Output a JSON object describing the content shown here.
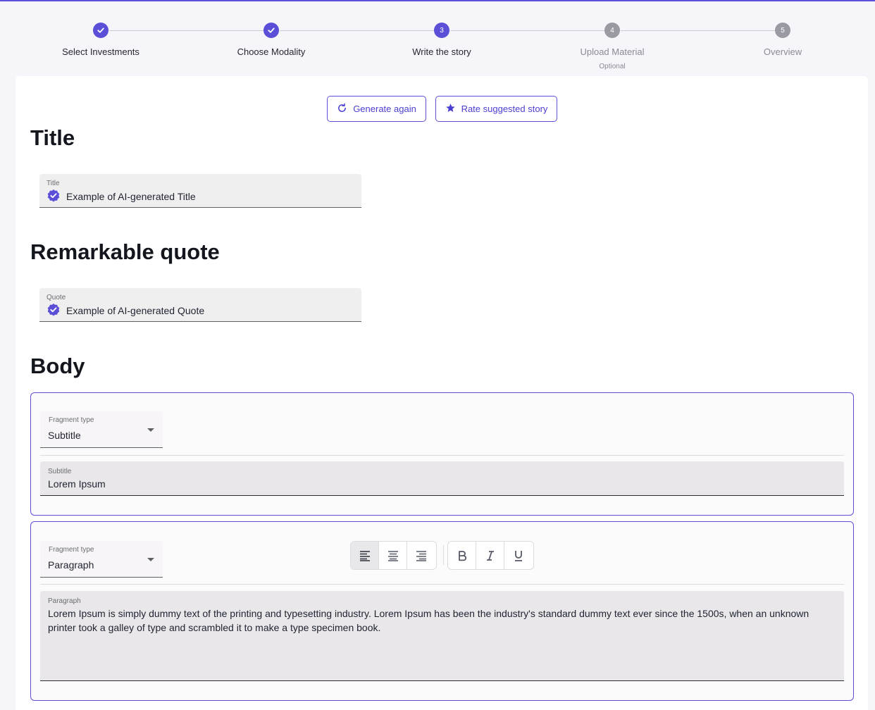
{
  "stepper": {
    "steps": [
      {
        "label": "Select Investments",
        "marker": "",
        "state": "done"
      },
      {
        "label": "Choose Modality",
        "marker": "",
        "state": "done"
      },
      {
        "label": "Write the story",
        "marker": "3",
        "state": "active"
      },
      {
        "label": "Upload Material",
        "marker": "4",
        "state": "todo",
        "sub": "Optional"
      },
      {
        "label": "Overview",
        "marker": "5",
        "state": "todo"
      }
    ]
  },
  "actions": {
    "generate_again": "Generate again",
    "rate_story": "Rate suggested story"
  },
  "title_section": {
    "heading": "Title",
    "field_label": "Title",
    "value": "Example of AI-generated Title"
  },
  "quote_section": {
    "heading": "Remarkable quote",
    "field_label": "Quote",
    "value": "Example of AI-generated Quote"
  },
  "body_section": {
    "heading": "Body",
    "fragments": [
      {
        "type_label": "Fragment type",
        "type_value": "Subtitle",
        "field_label": "Subtitle",
        "value": "Lorem Ipsum"
      },
      {
        "type_label": "Fragment type",
        "type_value": "Paragraph",
        "field_label": "Paragraph",
        "value": "Lorem Ipsum is simply dummy text of the printing and typesetting industry. Lorem Ipsum has been the industry's standard dummy text ever since the 1500s, when an unknown printer took a galley of type and scrambled it to make a type specimen book.",
        "toolbar": {
          "align": [
            "align-left-icon",
            "align-center-icon",
            "align-right-icon"
          ],
          "selected_align": "align-left-icon",
          "format": [
            "bold-icon",
            "italic-icon",
            "underline-icon"
          ]
        }
      }
    ]
  },
  "colors": {
    "accent": "#5b4fd8",
    "step_todo": "#9a9aa2",
    "background": "#f6f5f9"
  }
}
